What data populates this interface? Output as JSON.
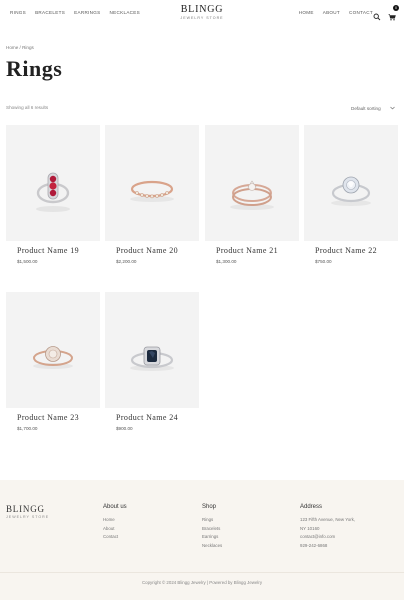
{
  "header": {
    "nav_left": [
      "Rings",
      "Bracelets",
      "Earrings",
      "Necklaces"
    ],
    "logo_name": "BLINGG",
    "logo_sub": "JEWELRY STORE",
    "nav_right": [
      "Home",
      "About",
      "Contact"
    ],
    "cart_count": "0",
    "search_icon": "search-icon",
    "cart_icon": "cart-icon"
  },
  "breadcrumb": "Home / Rings",
  "page_title": "Rings",
  "results_count": "Showing all 6 results",
  "sort": {
    "selected": "Default sorting"
  },
  "products": [
    {
      "name": "Product Name 19",
      "price": "$1,500.00",
      "stone": "#b01a3a",
      "band": "#c9c9cc"
    },
    {
      "name": "Product Name 20",
      "price": "$2,200.00",
      "stone": "#efe6da",
      "band": "#d9a38a"
    },
    {
      "name": "Product Name 21",
      "price": "$1,300.00",
      "stone": "#f5f2f0",
      "band": "#d6a896"
    },
    {
      "name": "Product Name 22",
      "price": "$750.00",
      "stone": "#dfe4ec",
      "band": "#c7c9ce"
    },
    {
      "name": "Product Name 23",
      "price": "$1,700.00",
      "stone": "#e9dcd3",
      "band": "#d4a48c"
    },
    {
      "name": "Product Name 24",
      "price": "$900.00",
      "stone": "#1c2a3e",
      "band": "#c8c9cd"
    }
  ],
  "footer": {
    "logo_name": "BLINGG",
    "logo_sub": "JEWELRY STORE",
    "about_title": "About us",
    "about_links": [
      "Home",
      "About",
      "Contact"
    ],
    "shop_title": "Shop",
    "shop_links": [
      "Rings",
      "Bracelets",
      "Earrings",
      "Necklaces"
    ],
    "address_title": "Address",
    "address_lines": [
      "123 Fifth Avenue, New York,",
      "NY 10160",
      "contact@info.com",
      "929-242-6868"
    ],
    "copyright": "Copyright © 2024 Blingg Jewelry | Powered by Blingg Jewelry"
  },
  "colors": {
    "footer_bg": "#f8f5f0",
    "product_bg": "#f3f3f3",
    "text_dark": "#222222"
  }
}
